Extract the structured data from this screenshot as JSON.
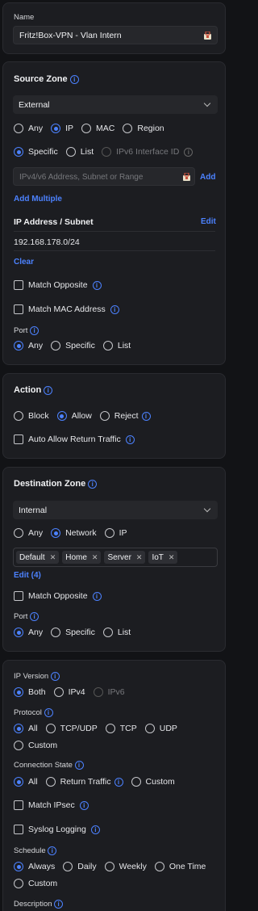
{
  "name_panel": {
    "label": "Name",
    "value": "Fritz!Box-VPN - Vlan Intern"
  },
  "source": {
    "heading": "Source Zone",
    "zone": "External",
    "match_type": [
      "Any",
      "IP",
      "MAC",
      "Region"
    ],
    "scope": [
      "Specific",
      "List",
      "IPv6 Interface ID"
    ],
    "address_placeholder": "IPv4/v6 Address, Subnet or Range",
    "add": "Add",
    "add_multiple": "Add Multiple",
    "ip_header": "IP Address / Subnet",
    "edit": "Edit",
    "ip_value": "192.168.178.0/24",
    "clear": "Clear",
    "match_opposite": "Match Opposite",
    "match_mac": "Match MAC Address",
    "port_label": "Port",
    "port_options": [
      "Any",
      "Specific",
      "List"
    ]
  },
  "action": {
    "heading": "Action",
    "options": [
      "Block",
      "Allow",
      "Reject"
    ],
    "auto_allow": "Auto Allow Return Traffic"
  },
  "destination": {
    "heading": "Destination Zone",
    "zone": "Internal",
    "match_type": [
      "Any",
      "Network",
      "IP"
    ],
    "tags": [
      "Default",
      "Home",
      "Server",
      "IoT"
    ],
    "edit": "Edit (4)",
    "match_opposite": "Match Opposite",
    "port_label": "Port",
    "port_options": [
      "Any",
      "Specific",
      "List"
    ]
  },
  "advanced": {
    "ip_version_label": "IP Version",
    "ip_version": [
      "Both",
      "IPv4",
      "IPv6"
    ],
    "protocol_label": "Protocol",
    "protocol": [
      "All",
      "TCP/UDP",
      "TCP",
      "UDP",
      "Custom"
    ],
    "conn_state_label": "Connection State",
    "conn_state": [
      "All",
      "Return Traffic",
      "Custom"
    ],
    "match_ipsec": "Match IPsec",
    "syslog": "Syslog Logging",
    "schedule_label": "Schedule",
    "schedule": [
      "Always",
      "Daily",
      "Weekly",
      "One Time",
      "Custom"
    ],
    "description_label": "Description"
  },
  "colors": {
    "accent": "#4c82ff",
    "panel": "#1c1d21",
    "background": "#121316"
  }
}
